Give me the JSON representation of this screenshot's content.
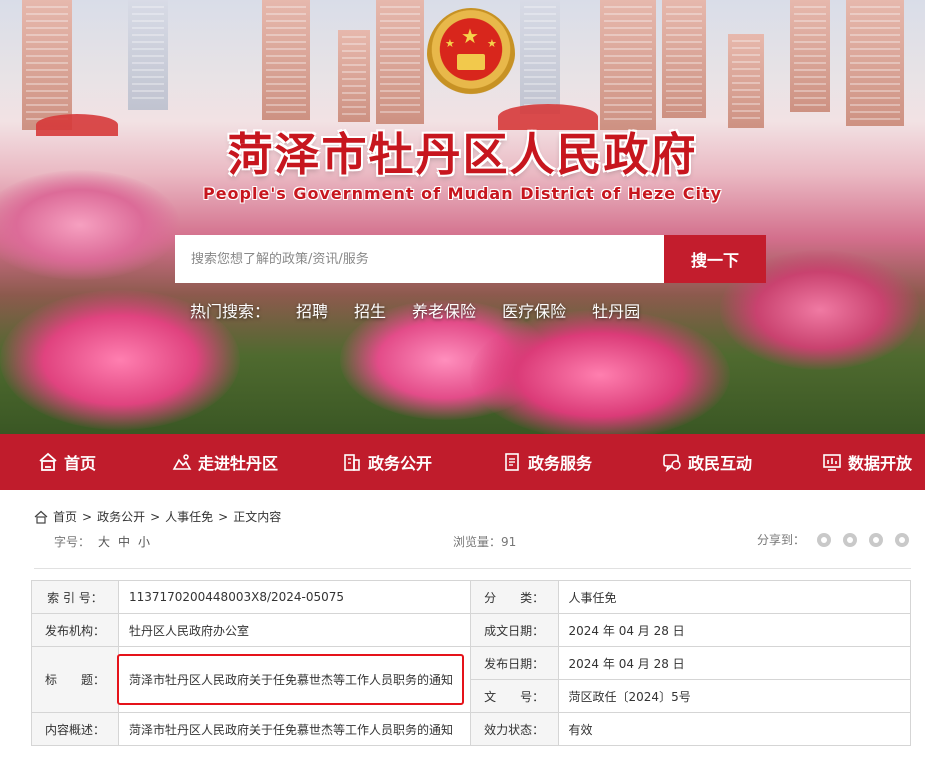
{
  "banner": {
    "title": "菏泽市牡丹区人民政府",
    "subtitle": "People's Government of Mudan District of Heze City",
    "search": {
      "placeholder": "搜索您想了解的政策/资讯/服务",
      "button": "搜一下"
    },
    "hot_label": "热门搜索：",
    "hot_keywords": [
      "招聘",
      "招生",
      "养老保险",
      "医疗保险",
      "牡丹园"
    ]
  },
  "nav": {
    "items": [
      {
        "label": "首页",
        "icon": "home-icon"
      },
      {
        "label": "走进牡丹区",
        "icon": "scenery-icon"
      },
      {
        "label": "政务公开",
        "icon": "building-icon"
      },
      {
        "label": "政务服务",
        "icon": "document-icon"
      },
      {
        "label": "政民互动",
        "icon": "chat-icon"
      },
      {
        "label": "数据开放",
        "icon": "chart-icon"
      }
    ]
  },
  "breadcrumb": [
    "首页",
    "政务公开",
    "人事任免",
    "正文内容"
  ],
  "tools": {
    "font_label": "字号：",
    "font_options": [
      "大",
      "中",
      "小"
    ],
    "views": "浏览量：91",
    "share_label": "分享到："
  },
  "info": {
    "index_label": "索 引 号：",
    "index_value": "1137170200448003X8/2024-05075",
    "category_label": "分　　类：",
    "category_value": "人事任免",
    "org_label": "发布机构：",
    "org_value": "牡丹区人民政府办公室",
    "created_label": "成文日期：",
    "created_value": "2024 年 04 月 28 日",
    "title_label": "标　　题：",
    "title_value": "菏泽市牡丹区人民政府关于任免慕世杰等工作人员职务的通知",
    "published_label": "发布日期：",
    "published_value": "2024 年 04 月 28 日",
    "doc_no_label": "文　　号：",
    "doc_no_value": "菏区政任〔2024〕5号",
    "summary_label": "内容概述：",
    "summary_value": "菏泽市牡丹区人民政府关于任免慕世杰等工作人员职务的通知",
    "status_label": "效力状态：",
    "status_value": "有效"
  },
  "colors": {
    "brand_red": "#c01c2c",
    "highlight": "#e5131a"
  }
}
